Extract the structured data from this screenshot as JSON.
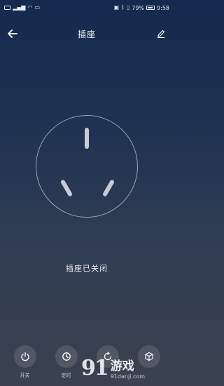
{
  "status_bar": {
    "left_icons": [
      "hd-icon",
      "signal-icon",
      "wifi-icon",
      "notification-icon"
    ],
    "battery": "79%",
    "time": "9:58"
  },
  "header": {
    "title": "插座"
  },
  "socket": {
    "status_text": "插座已关闭"
  },
  "tabs": [
    {
      "label": "开关",
      "icon": "power-icon"
    },
    {
      "label": "定时",
      "icon": "clock-icon"
    },
    {
      "label": "",
      "icon": "refresh-icon"
    },
    {
      "label": "",
      "icon": "cube-icon"
    }
  ],
  "watermark": {
    "logo": "91",
    "name": "游戏",
    "url": "91danji.com"
  }
}
